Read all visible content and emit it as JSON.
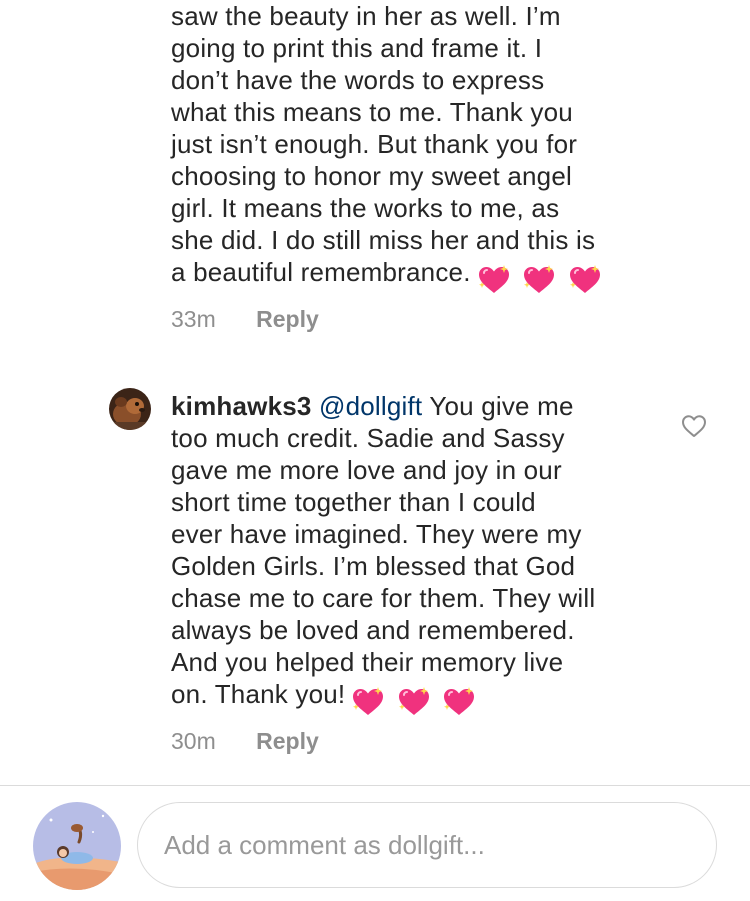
{
  "comments": [
    {
      "lines": [
        "saw the beauty in her as well. I’m",
        "going to print this and frame it. I",
        "don’t have the words to express",
        "what this means to me. Thank you",
        "just isn’t enough. But thank you for",
        "choosing to honor my sweet angel",
        "girl. It means the works to me, as",
        "she did. I do still miss her and this is"
      ],
      "last_line": "a beautiful remembrance.",
      "emoji": [
        "sparkling-heart",
        "sparkling-heart",
        "sparkling-heart"
      ],
      "time": "33m",
      "reply_label": "Reply"
    },
    {
      "username": "kimhawks3",
      "mention": "@dollgift",
      "first_line_rest": " You give me",
      "lines": [
        "too much credit. Sadie and Sassy",
        "gave me more love and joy in our",
        "short time together than I could",
        "ever have imagined. They were my",
        "Golden Girls. I’m blessed that God",
        "chase me to care for them. They will",
        "always be loved and remembered.",
        "And you helped their memory live"
      ],
      "last_line": "on. Thank you!",
      "emoji": [
        "sparkling-heart",
        "sparkling-heart",
        "sparkling-heart"
      ],
      "time": "30m",
      "reply_label": "Reply",
      "like_icon": "heart-outline-icon"
    }
  ],
  "composer": {
    "placeholder": "Add a comment as dollgift..."
  },
  "colors": {
    "text": "#262626",
    "mention": "#003569",
    "meta": "#8e8e8e",
    "border": "#dbdbdb",
    "heart": "#f0327e"
  }
}
